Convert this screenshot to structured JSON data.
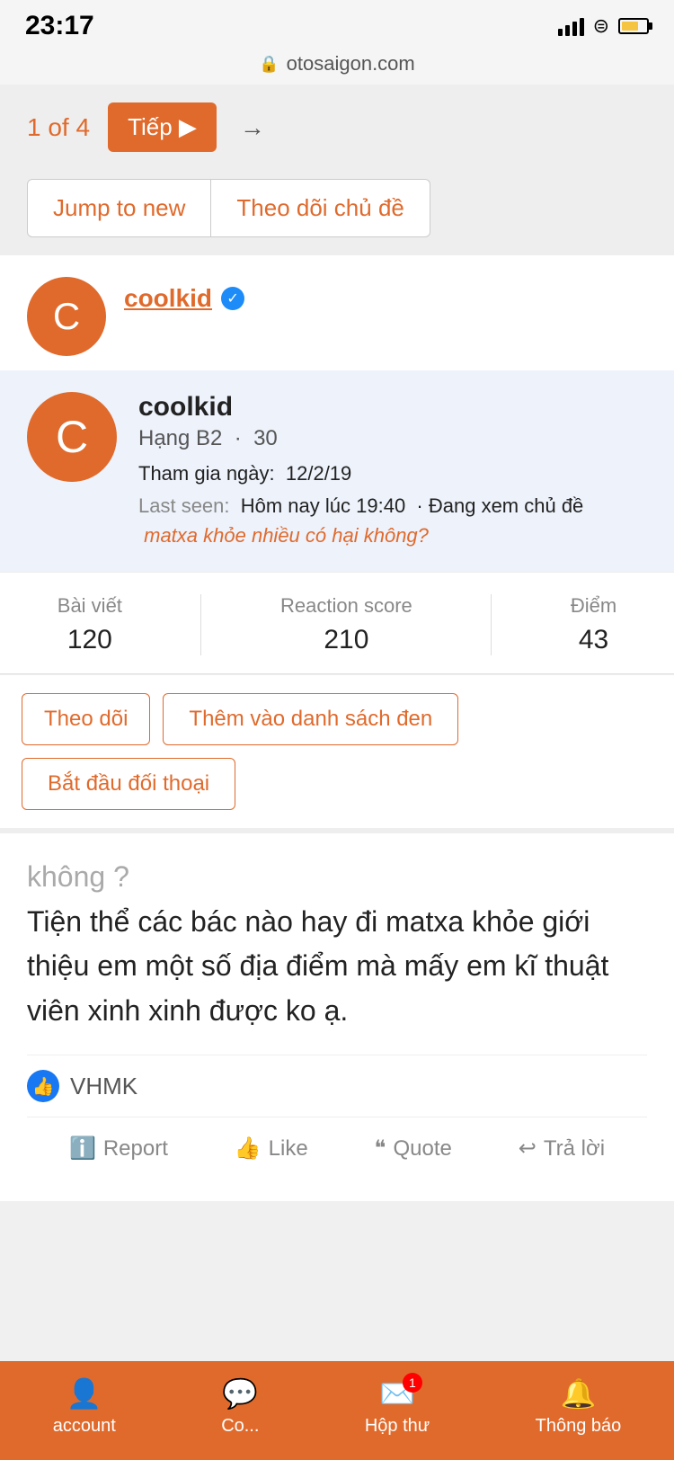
{
  "statusBar": {
    "time": "23:17",
    "url": "otosaigon.com"
  },
  "nav": {
    "pageIndicator": "1 of 4",
    "tiepLabel": "Tiếp ▶",
    "arrowRight": "→"
  },
  "actionButtons": {
    "jumpToNew": "Jump to new",
    "theoDoi": "Theo dõi chủ đề"
  },
  "userCard": {
    "avatarLetter": "C",
    "username": "coolkid",
    "verified": "✓"
  },
  "popup": {
    "avatarLetter": "C",
    "name": "coolkid",
    "rank": "Hạng B2",
    "rankScore": "30",
    "joinLabel": "Tham gia ngày:",
    "joinDate": "12/2/19",
    "lastSeenLabel": "Last seen:",
    "lastSeenValue": "Hôm nay lúc 19:40",
    "lastSeenPrefix": "· Đang xem chủ đề",
    "lastSeenTopic": "matxa khỏe nhiều có hại không?"
  },
  "stats": {
    "baiVietLabel": "Bài viết",
    "baiVietValue": "120",
    "reactionLabel": "Reaction score",
    "reactionValue": "210",
    "diemLabel": "Điểm",
    "diemValue": "43"
  },
  "cardButtons": {
    "theoDoi": "Theo dõi",
    "themVao": "Thêm vào danh sách đen",
    "batDau": "Bắt đầu đối thoại"
  },
  "content": {
    "partialText": "không ?",
    "mainText": "Tiện thể các bác nào hay đi matxa khỏe giới thiệu em một số địa điểm mà mấy em kĩ thuật viên xinh xinh được ko ạ."
  },
  "reactions": {
    "name": "VHMK"
  },
  "actionBarItems": {
    "report": "Report",
    "like": "Like",
    "quote": "Quote",
    "reply": "Trả lời"
  },
  "bottomNav": {
    "account": "account",
    "comment": "Co...",
    "inbox": "Hộp thư",
    "inboxBadge": "1",
    "notifications": "Thông báo"
  }
}
